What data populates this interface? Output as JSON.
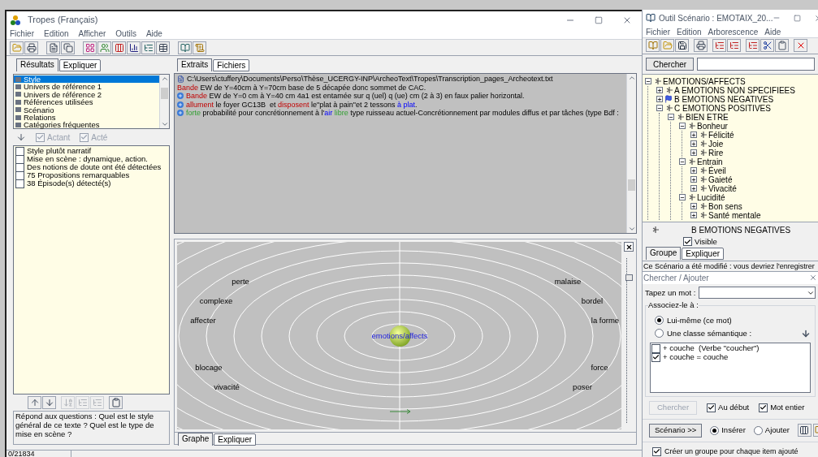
{
  "main_window": {
    "title": "Tropes (Français)",
    "menu": [
      "Fichier",
      "Edition",
      "Afficher",
      "Outils",
      "Aide"
    ],
    "status": "0/21834"
  },
  "left_panel": {
    "tabs": [
      {
        "label": "Résultats",
        "selected": true
      },
      {
        "label": "Expliquer",
        "selected": false
      }
    ],
    "categories": [
      {
        "label": "Style",
        "selected": true
      },
      {
        "label": "Univers de référence 1",
        "selected": false
      },
      {
        "label": "Univers de référence 2",
        "selected": false
      },
      {
        "label": "Références utilisées",
        "selected": false
      },
      {
        "label": "Scénario",
        "selected": false
      },
      {
        "label": "Relations",
        "selected": false
      },
      {
        "label": "Catégories fréquentes",
        "selected": false
      }
    ],
    "filters": [
      {
        "label": "Actant",
        "checked": true,
        "disabled": true
      },
      {
        "label": "Acté",
        "checked": true,
        "disabled": true
      }
    ],
    "results": [
      {
        "label": "Style plutôt narratif",
        "checked": false
      },
      {
        "label": "Mise en scène : dynamique, action.",
        "checked": false
      },
      {
        "label": "Des notions de doute ont été détectées",
        "checked": false
      },
      {
        "label": "75 Propositions remarquables",
        "checked": false
      },
      {
        "label": "38 Épisode(s) détecté(s)",
        "checked": false
      }
    ],
    "description": "Répond aux questions : Quel est le style général de ce texte ? Quel est le type de mise en scène ?"
  },
  "extracts": {
    "tabs": [
      {
        "label": "Extraits",
        "selected": true
      },
      {
        "label": "Fichiers",
        "selected": false
      }
    ],
    "path": "C:\\Users\\ctuffery\\Documents\\Perso\\Thèse_UCERGY-INP\\ArcheoText\\Tropes\\Transcription_pages_Archeotext.txt",
    "lines": [
      {
        "bullet": false,
        "segments": [
          {
            "text": "Bande",
            "kind": "actor"
          },
          {
            "text": " EW de Y=40cm à Y=70cm base de 5 décapée donc sommet de CAC."
          }
        ]
      },
      {
        "bullet": true,
        "segments": [
          {
            "text": "Bande",
            "kind": "actor"
          },
          {
            "text": " EW de Y=0 cm à Y=40 cm 4a1 est entamée sur q (uel) q (ue) cm (2 à 3) en faux palier horizontal."
          }
        ]
      },
      {
        "bullet": true,
        "segments": [
          {
            "text": "allument",
            "kind": "actor"
          },
          {
            "text": " le foyer GC13B  et "
          },
          {
            "text": "disposent",
            "kind": "actor"
          },
          {
            "text": " le\"plat à pain\"et 2 tessons "
          },
          {
            "text": "à plat",
            "kind": "place"
          },
          {
            "text": "."
          }
        ]
      },
      {
        "bullet": true,
        "segments": [
          {
            "text": "forte",
            "kind": "quality"
          },
          {
            "text": " probabilité pour concrétionnement à l'"
          },
          {
            "text": "air",
            "kind": "place"
          },
          {
            "text": " libre",
            "kind": "quality"
          },
          {
            "text": " type ruisseau actuel-Concrétionnement par modules diffus et par tâches (type Bdf :"
          }
        ]
      }
    ]
  },
  "graph": {
    "center": "emotions/affects",
    "words": [
      "perte",
      "complexe",
      "affecter",
      "blocage",
      "vivacité",
      "malaise",
      "bordel",
      "la forme",
      "force",
      "poser"
    ],
    "slider": {
      "level": 0.9
    },
    "tabs": [
      {
        "label": "Graphe",
        "selected": true
      },
      {
        "label": "Expliquer",
        "selected": false
      }
    ]
  },
  "scenario_window": {
    "title": "Outil Scénario : EMOTAIX_20...",
    "menu": [
      "Fichier",
      "Edition",
      "Arborescence",
      "Aide"
    ],
    "search_button": "Chercher",
    "tree": [
      {
        "label": "EMOTIONS/AFFECTS",
        "expanded": true,
        "selected": false,
        "children": [
          {
            "label": "A EMOTIONS NON SPECIFIEES",
            "expanded": false,
            "selected": false
          },
          {
            "label": "B EMOTIONS NEGATIVES",
            "expanded": false,
            "selected": true
          },
          {
            "label": "C EMOTIONS POSITIVES",
            "expanded": true,
            "selected": false,
            "children": [
              {
                "label": "BIEN ETRE",
                "expanded": true,
                "selected": false,
                "children": [
                  {
                    "label": "Bonheur",
                    "expanded": true,
                    "selected": false,
                    "children": [
                      {
                        "label": "Félicité",
                        "expanded": false,
                        "selected": false
                      },
                      {
                        "label": "Joie",
                        "expanded": false,
                        "selected": false
                      },
                      {
                        "label": "Rire",
                        "expanded": false,
                        "selected": false
                      }
                    ]
                  },
                  {
                    "label": "Entrain",
                    "expanded": true,
                    "selected": false,
                    "children": [
                      {
                        "label": "Éveil",
                        "expanded": false,
                        "selected": false
                      },
                      {
                        "label": "Gaieté",
                        "expanded": false,
                        "selected": false
                      },
                      {
                        "label": "Vivacité",
                        "expanded": false,
                        "selected": false
                      }
                    ]
                  },
                  {
                    "label": "Lucidité",
                    "expanded": true,
                    "selected": false,
                    "children": [
                      {
                        "label": "Bon sens",
                        "expanded": false,
                        "selected": false
                      },
                      {
                        "label": "Santé mentale",
                        "expanded": false,
                        "selected": false
                      }
                    ]
                  }
                ]
              }
            ]
          }
        ]
      }
    ],
    "detail": {
      "name": "B EMOTIONS NEGATIVES",
      "visible": {
        "label": "Visible",
        "checked": true
      }
    },
    "tabs": [
      {
        "label": "Groupe",
        "selected": true
      },
      {
        "label": "Expliquer",
        "selected": false
      }
    ],
    "status": "Ce Scénario a été modifié : vous devriez l'enregistrer"
  },
  "search_add": {
    "title": "Chercher / Ajouter",
    "word_label": "Tapez un mot :",
    "group_label": "Associez-le à :",
    "targets": [
      {
        "label": "Lui-même (ce mot)",
        "selected": true
      },
      {
        "label": "Une classe sémantique :",
        "selected": false
      }
    ],
    "matches": [
      {
        "label": "+ couche  (Verbe \"coucher\")",
        "checked": false
      },
      {
        "label": "+ couche = couche",
        "checked": true
      }
    ],
    "search_button": {
      "label": "Chercher",
      "disabled": true
    },
    "options": [
      {
        "label": "Au début",
        "checked": true
      },
      {
        "label": "Mot entier",
        "checked": true
      }
    ],
    "scenario_button": "Scénario >>",
    "modes": [
      {
        "label": "Insérer",
        "selected": true
      },
      {
        "label": "Ajouter",
        "selected": false
      }
    ],
    "group_option": {
      "label": "Créer un groupe pour chaque item ajouté",
      "checked": true
    }
  }
}
